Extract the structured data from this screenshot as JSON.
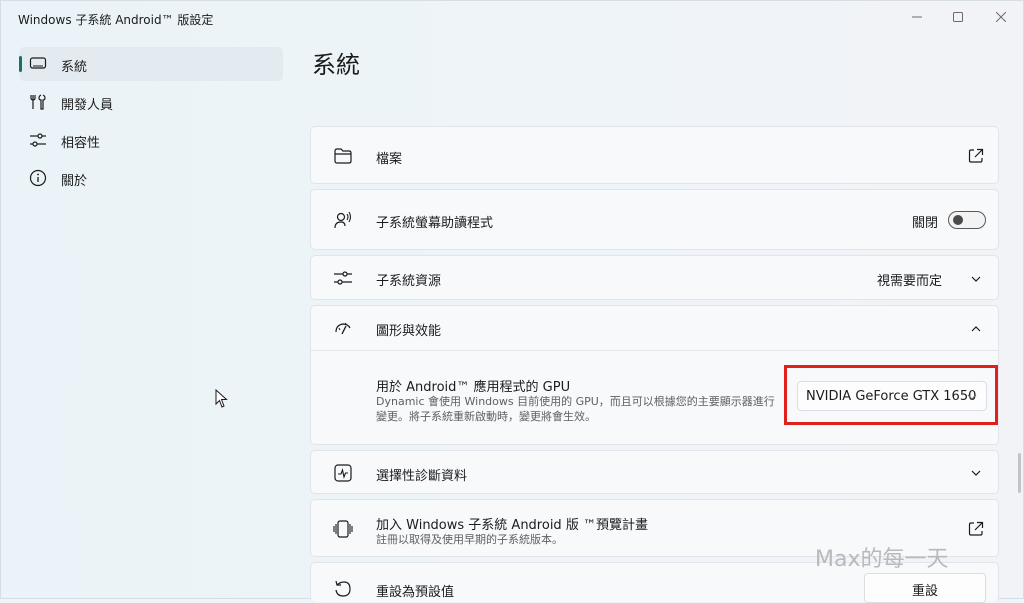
{
  "window": {
    "title": "Windows 子系統 Android™ 版設定"
  },
  "sidebar": {
    "items": [
      {
        "label": "系統",
        "icon": "monitor-icon",
        "active": true
      },
      {
        "label": "開發人員",
        "icon": "tools-icon",
        "active": false
      },
      {
        "label": "相容性",
        "icon": "sliders-icon",
        "active": false
      },
      {
        "label": "關於",
        "icon": "info-icon",
        "active": false
      }
    ]
  },
  "main": {
    "title": "系統",
    "rows": {
      "files": {
        "label": "檔案",
        "icon": "folder-icon",
        "action_icon": "external-link-icon"
      },
      "screen_reader": {
        "label": "子系統螢幕助讀程式",
        "icon": "screen-reader-icon",
        "state_label": "關閉",
        "toggle_on": false
      },
      "resources": {
        "label": "子系統資源",
        "icon": "sliders-icon",
        "value": "視需要而定"
      },
      "graphics": {
        "label": "圖形與效能",
        "icon": "gauge-icon",
        "gpu": {
          "label": "用於 Android™ 應用程式的 GPU",
          "description_line1": "Dynamic 會使用 Windows 目前使用的 GPU，而且可以根據您的主要顯示器進行",
          "description_line2": "變更。將子系統重新啟動時，變更將會生效。",
          "selected": "NVIDIA GeForce GTX 1650"
        }
      },
      "diagnostics": {
        "label": "選擇性診斷資料",
        "icon": "pulse-icon"
      },
      "preview": {
        "label": "加入 Windows 子系統 Android 版 ™預覽計畫",
        "sub": "註冊以取得及使用早期的子系統版本。",
        "icon": "preview-icon",
        "action_icon": "external-link-icon"
      },
      "reset": {
        "label": "重設為預設值",
        "icon": "reset-icon",
        "button_label": "重設"
      }
    }
  },
  "watermark": "Max的每一天",
  "colors": {
    "accent": "#1a6f69",
    "highlight": "#e0201a"
  }
}
